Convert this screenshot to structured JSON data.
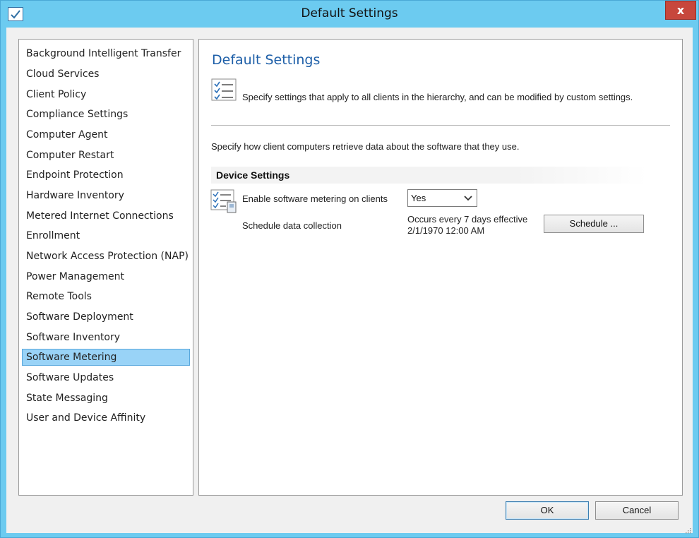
{
  "window": {
    "title": "Default Settings",
    "close_glyph": "x"
  },
  "nav": {
    "items": [
      {
        "label": "Background Intelligent Transfer"
      },
      {
        "label": "Cloud Services"
      },
      {
        "label": "Client Policy"
      },
      {
        "label": "Compliance Settings"
      },
      {
        "label": "Computer Agent"
      },
      {
        "label": "Computer Restart"
      },
      {
        "label": "Endpoint Protection"
      },
      {
        "label": "Hardware Inventory"
      },
      {
        "label": "Metered Internet Connections"
      },
      {
        "label": "Enrollment"
      },
      {
        "label": "Network Access Protection (NAP)"
      },
      {
        "label": "Power Management"
      },
      {
        "label": "Remote Tools"
      },
      {
        "label": "Software Deployment"
      },
      {
        "label": "Software Inventory"
      },
      {
        "label": "Software Metering"
      },
      {
        "label": "Software Updates"
      },
      {
        "label": "State Messaging"
      },
      {
        "label": "User and Device Affinity"
      }
    ],
    "selected_label": "Software Metering"
  },
  "panel": {
    "title": "Default Settings",
    "description": "Specify settings that apply to all clients in the hierarchy, and can be modified by custom settings.",
    "sub_description": "Specify how client computers retrieve data about the software that they use.",
    "group_header": "Device Settings",
    "enable_label": "Enable software metering on clients",
    "enable_value": "Yes",
    "schedule_label": "Schedule data collection",
    "occurs_line1": "Occurs every 7 days effective",
    "occurs_line2": "2/1/1970 12:00 AM",
    "schedule_button": "Schedule ..."
  },
  "footer": {
    "ok_label": "OK",
    "cancel_label": "Cancel"
  },
  "icons": {
    "app": "checklist-app-icon",
    "close": "close-icon",
    "description": "checklist-icon",
    "setting": "metering-settings-icon",
    "dropdown": "chevron-down-icon",
    "grip": "resize-grip-icon"
  },
  "colors": {
    "titlebar": "#6ccbf0",
    "close_button": "#c7473c",
    "title_accent": "#1e5fa8",
    "selection": "#99d3f7"
  }
}
